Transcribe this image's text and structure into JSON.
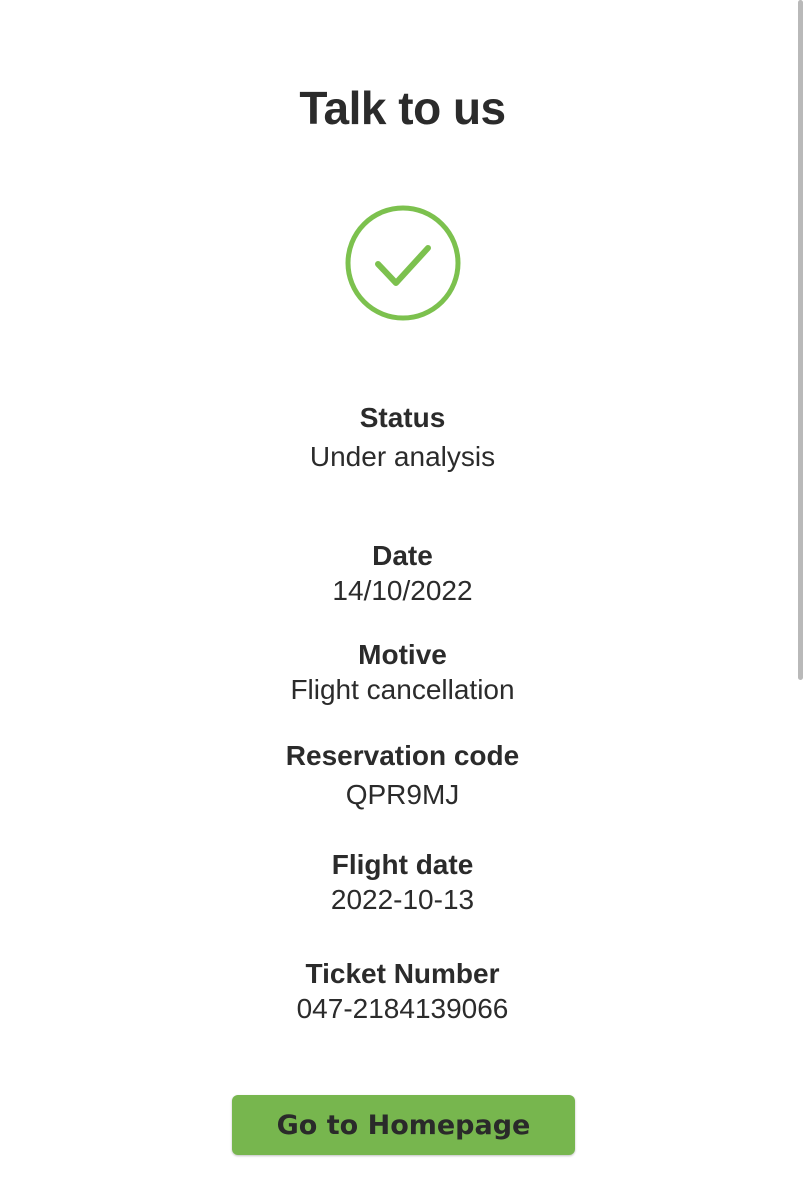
{
  "page": {
    "title": "Talk to us"
  },
  "status_icon": {
    "icon": "check-circle-icon",
    "color": "#7cc14e"
  },
  "details": {
    "status": {
      "label": "Status",
      "value": "Under analysis"
    },
    "date": {
      "label": "Date",
      "value": "14/10/2022"
    },
    "motive": {
      "label": "Motive",
      "value": "Flight cancellation"
    },
    "reservation_code": {
      "label": "Reservation code",
      "value": "QPR9MJ"
    },
    "flight_date": {
      "label": "Flight date",
      "value": "2022-10-13"
    },
    "ticket_number": {
      "label": "Ticket Number",
      "value": "047-2184139066"
    }
  },
  "actions": {
    "home_label": "Go to Homepage",
    "accent": "#77b64e"
  }
}
